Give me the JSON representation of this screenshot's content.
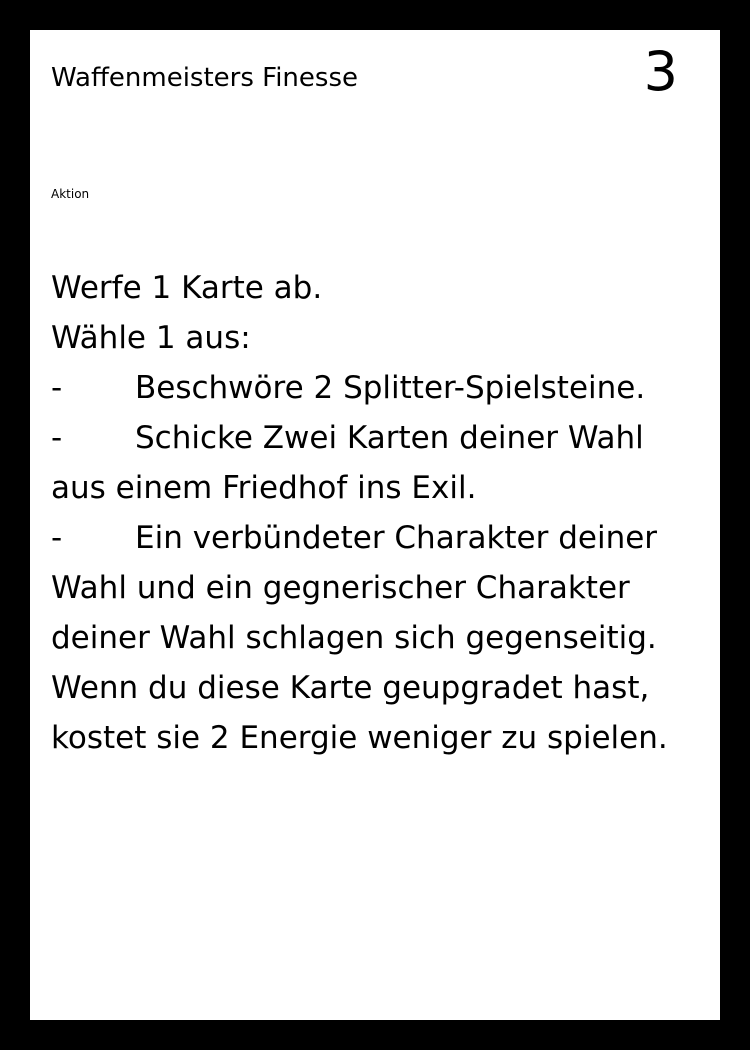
{
  "card": {
    "title": "Waffenmeisters Finesse",
    "cost": "3",
    "type": "Aktion",
    "text_lines": [
      {
        "dash": "",
        "text": "Werfe 1 Karte ab."
      },
      {
        "dash": "",
        "text": "Wähle 1 aus:"
      },
      {
        "dash": "-",
        "text": "Beschwöre 2 Splitter-Spielsteine."
      },
      {
        "dash": "-",
        "text": "Schicke Zwei Karten deiner Wahl"
      },
      {
        "dash": "",
        "text": "aus einem Friedhof ins Exil."
      },
      {
        "dash": "-",
        "text": "Ein verbündeter Charakter deiner"
      },
      {
        "dash": "",
        "text": "Wahl und ein gegnerischer Charakter"
      },
      {
        "dash": "",
        "text": "deiner Wahl schlagen sich gegenseitig."
      },
      {
        "dash": "",
        "text": "Wenn du diese Karte geupgradet hast,"
      },
      {
        "dash": "",
        "text": "kostet sie 2 Energie weniger zu spielen."
      }
    ]
  }
}
